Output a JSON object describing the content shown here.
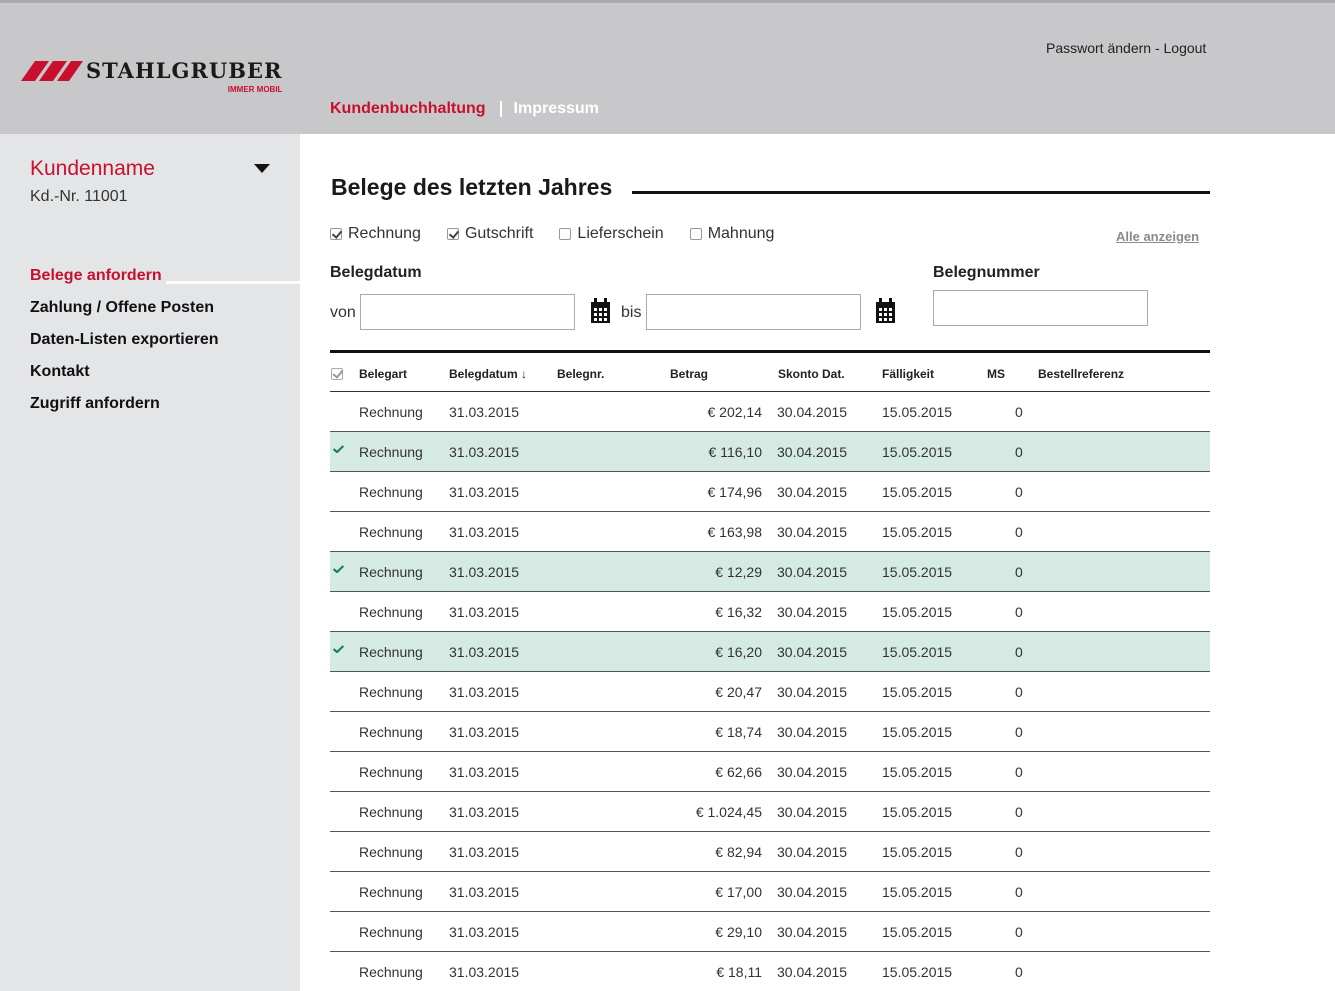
{
  "brand": {
    "name": "STAHLGRUBER",
    "tagline": "IMMER MOBIL"
  },
  "header": {
    "account_links": "Passwort ändern - Logout",
    "nav": [
      {
        "label": "Kundenbuchhaltung",
        "active": true
      },
      {
        "label": "Impressum",
        "active": false
      }
    ]
  },
  "sidebar": {
    "customer_name": "Kundenname",
    "customer_number": "Kd.-Nr. 11001",
    "menu": [
      {
        "label": "Belege anfordern",
        "active": true
      },
      {
        "label": "Zahlung / Offene Posten",
        "active": false
      },
      {
        "label": "Daten-Listen exportieren",
        "active": false
      },
      {
        "label": "Kontakt",
        "active": false
      },
      {
        "label": "Zugriff anfordern",
        "active": false
      }
    ]
  },
  "main": {
    "title": "Belege des letzten Jahres",
    "filters": [
      {
        "label": "Rechnung",
        "checked": true
      },
      {
        "label": "Gutschrift",
        "checked": true
      },
      {
        "label": "Lieferschein",
        "checked": false
      },
      {
        "label": "Mahnung",
        "checked": false
      }
    ],
    "show_all": "Alle anzeigen",
    "date_label": "Belegdatum",
    "from_label": "von",
    "to_label": "bis",
    "number_label": "Belegnummer",
    "from_value": "",
    "to_value": "",
    "number_value": ""
  },
  "table": {
    "columns": [
      "Belegart",
      "Belegdatum ↓",
      "Belegnr.",
      "Betrag",
      "Skonto Dat.",
      "Fälligkeit",
      "MS",
      "Bestellreferenz"
    ],
    "rows": [
      {
        "selected": false,
        "art": "Rechnung",
        "datum": "31.03.2015",
        "nr": "",
        "betrag": "€ 202,14",
        "skonto": "30.04.2015",
        "faellig": "15.05.2015",
        "ms": "0",
        "ref": ""
      },
      {
        "selected": true,
        "art": "Rechnung",
        "datum": "31.03.2015",
        "nr": "",
        "betrag": "€ 116,10",
        "skonto": "30.04.2015",
        "faellig": "15.05.2015",
        "ms": "0",
        "ref": ""
      },
      {
        "selected": false,
        "art": "Rechnung",
        "datum": "31.03.2015",
        "nr": "",
        "betrag": "€ 174,96",
        "skonto": "30.04.2015",
        "faellig": "15.05.2015",
        "ms": "0",
        "ref": ""
      },
      {
        "selected": false,
        "art": "Rechnung",
        "datum": "31.03.2015",
        "nr": "",
        "betrag": "€ 163,98",
        "skonto": "30.04.2015",
        "faellig": "15.05.2015",
        "ms": "0",
        "ref": ""
      },
      {
        "selected": true,
        "art": "Rechnung",
        "datum": "31.03.2015",
        "nr": "",
        "betrag": "€ 12,29",
        "skonto": "30.04.2015",
        "faellig": "15.05.2015",
        "ms": "0",
        "ref": ""
      },
      {
        "selected": false,
        "art": "Rechnung",
        "datum": "31.03.2015",
        "nr": "",
        "betrag": "€ 16,32",
        "skonto": "30.04.2015",
        "faellig": "15.05.2015",
        "ms": "0",
        "ref": ""
      },
      {
        "selected": true,
        "art": "Rechnung",
        "datum": "31.03.2015",
        "nr": "",
        "betrag": "€ 16,20",
        "skonto": "30.04.2015",
        "faellig": "15.05.2015",
        "ms": "0",
        "ref": ""
      },
      {
        "selected": false,
        "art": "Rechnung",
        "datum": "31.03.2015",
        "nr": "",
        "betrag": "€ 20,47",
        "skonto": "30.04.2015",
        "faellig": "15.05.2015",
        "ms": "0",
        "ref": ""
      },
      {
        "selected": false,
        "art": "Rechnung",
        "datum": "31.03.2015",
        "nr": "",
        "betrag": "€ 18,74",
        "skonto": "30.04.2015",
        "faellig": "15.05.2015",
        "ms": "0",
        "ref": ""
      },
      {
        "selected": false,
        "art": "Rechnung",
        "datum": "31.03.2015",
        "nr": "",
        "betrag": "€ 62,66",
        "skonto": "30.04.2015",
        "faellig": "15.05.2015",
        "ms": "0",
        "ref": ""
      },
      {
        "selected": false,
        "art": "Rechnung",
        "datum": "31.03.2015",
        "nr": "",
        "betrag": "€ 1.024,45",
        "skonto": "30.04.2015",
        "faellig": "15.05.2015",
        "ms": "0",
        "ref": ""
      },
      {
        "selected": false,
        "art": "Rechnung",
        "datum": "31.03.2015",
        "nr": "",
        "betrag": "€ 82,94",
        "skonto": "30.04.2015",
        "faellig": "15.05.2015",
        "ms": "0",
        "ref": ""
      },
      {
        "selected": false,
        "art": "Rechnung",
        "datum": "31.03.2015",
        "nr": "",
        "betrag": "€ 17,00",
        "skonto": "30.04.2015",
        "faellig": "15.05.2015",
        "ms": "0",
        "ref": ""
      },
      {
        "selected": false,
        "art": "Rechnung",
        "datum": "31.03.2015",
        "nr": "",
        "betrag": "€ 29,10",
        "skonto": "30.04.2015",
        "faellig": "15.05.2015",
        "ms": "0",
        "ref": ""
      },
      {
        "selected": false,
        "art": "Rechnung",
        "datum": "31.03.2015",
        "nr": "",
        "betrag": "€ 18,11",
        "skonto": "30.04.2015",
        "faellig": "15.05.2015",
        "ms": "0",
        "ref": ""
      }
    ]
  },
  "colors": {
    "brand_red": "#c8102e",
    "header_gray": "#c8c8ca",
    "sidebar_gray": "#e4e5e7",
    "selected_row": "#d4eae2",
    "check_green": "#0e7a5a"
  },
  "icons": {
    "logo": "stahlgruber-logo",
    "calendar": "calendar-icon",
    "dropdown": "caret-down-icon",
    "row_check": "checkmark-icon"
  }
}
